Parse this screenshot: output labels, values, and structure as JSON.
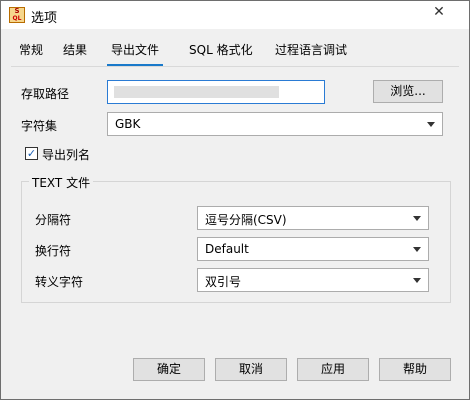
{
  "window": {
    "title": "选项",
    "app_icon": "sql-app-icon",
    "close_symbol": "✕"
  },
  "tabs": [
    {
      "label": "常规",
      "active": false
    },
    {
      "label": "结果",
      "active": false
    },
    {
      "label": "导出文件",
      "active": true
    },
    {
      "label": "SQL 格式化",
      "active": false
    },
    {
      "label": "过程语言调试",
      "active": false
    }
  ],
  "export": {
    "path_label": "存取路径",
    "path_value": "",
    "browse_label": "浏览...",
    "charset_label": "字符集",
    "charset_value": "GBK",
    "export_colnames_label": "导出列名",
    "export_colnames_checked": true,
    "check_mark": "✓"
  },
  "text_file": {
    "group_title": "TEXT 文件",
    "delimiter_label": "分隔符",
    "delimiter_value": "逗号分隔(CSV)",
    "newline_label": "换行符",
    "newline_value": "Default",
    "escape_label": "转义字符",
    "escape_value": "双引号"
  },
  "footer": {
    "ok_label": "确定",
    "cancel_label": "取消",
    "apply_label": "应用",
    "help_label": "帮助"
  },
  "colors": {
    "accent": "#1979ca",
    "window_bg": "#f0f0f0"
  }
}
